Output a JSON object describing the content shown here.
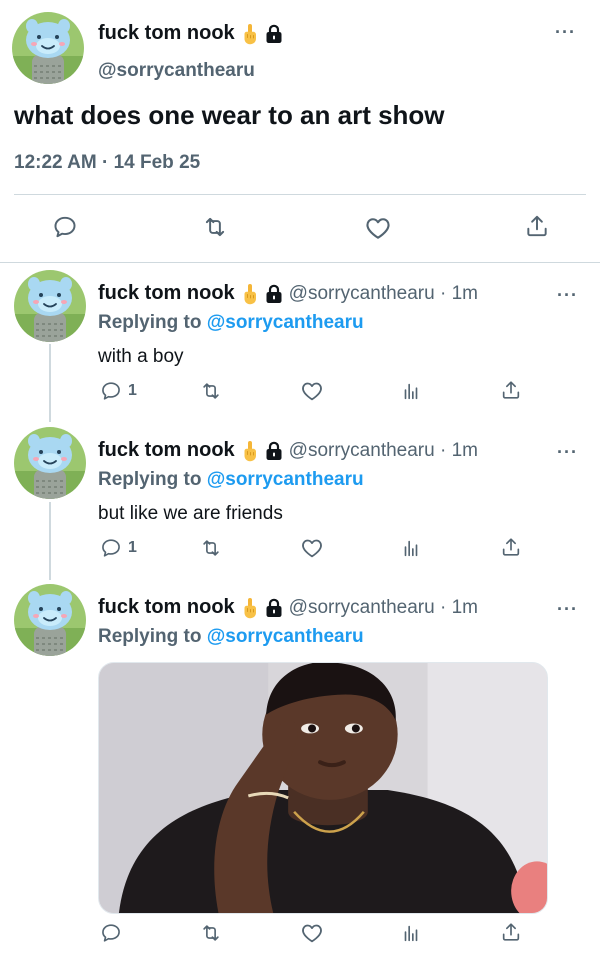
{
  "main_tweet": {
    "display_name": "fuck tom nook",
    "handle": "@sorrycanthearu",
    "text": "what does one wear to an art show",
    "timestamp": "12:22 AM · 14 Feb 25",
    "more_label": "···"
  },
  "replies": [
    {
      "display_name": "fuck tom nook",
      "handle_time": "@sorrycanthearu · 1m",
      "replying_prefix": "Replying to",
      "replying_to": "@sorrycanthearu",
      "text": "with a boy",
      "reply_count": "1",
      "more_label": "···"
    },
    {
      "display_name": "fuck tom nook",
      "handle_time": "@sorrycanthearu · 1m",
      "replying_prefix": "Replying to",
      "replying_to": "@sorrycanthearu",
      "text": "but like we are friends",
      "reply_count": "1",
      "more_label": "···"
    },
    {
      "display_name": "fuck tom nook",
      "handle_time": "@sorrycanthearu · 1m",
      "replying_prefix": "Replying to",
      "replying_to": "@sorrycanthearu",
      "has_media": true,
      "more_label": "···"
    }
  ],
  "icons": {
    "reply": "reply-icon",
    "retweet": "retweet-icon",
    "like": "like-icon",
    "analytics": "analytics-icon",
    "share": "share-icon",
    "lock": "lock-icon",
    "emoji": "middle-finger-emoji-icon",
    "more": "more-icon"
  },
  "colors": {
    "accent": "#1d9bf0",
    "secondary_text": "#536471",
    "divider": "#cfd9de"
  }
}
